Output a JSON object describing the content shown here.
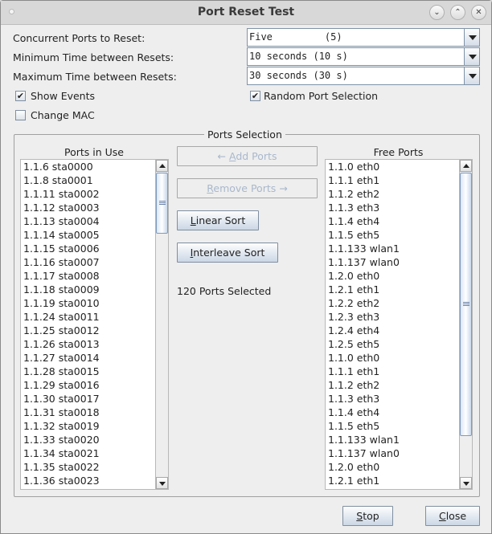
{
  "window": {
    "title": "Port Reset Test"
  },
  "form": {
    "concurrent": {
      "label": "Concurrent Ports to Reset:",
      "value": "Five         (5)"
    },
    "min_time": {
      "label": "Minimum Time between Resets:",
      "value": "10 seconds (10 s)"
    },
    "max_time": {
      "label": "Maximum Time between Resets:",
      "value": "30 seconds (30 s)"
    },
    "show_events": {
      "label": "Show Events",
      "checked": true
    },
    "random_port": {
      "label": "Random Port Selection",
      "checked": true
    },
    "change_mac": {
      "label": "Change MAC",
      "checked": false
    }
  },
  "ports": {
    "group_title": "Ports Selection",
    "in_use_header": "Ports in Use",
    "free_header": "Free Ports",
    "add_prefix": "← ",
    "add_u": "A",
    "add_rest": "dd Ports",
    "remove_u": "R",
    "remove_rest": "emove Ports →",
    "linear_u": "L",
    "linear_rest": "inear Sort",
    "interleave_u": "I",
    "interleave_rest": "nterleave Sort",
    "selected_status": "120 Ports Selected",
    "in_use": [
      "1.1.6 sta0000",
      "1.1.8 sta0001",
      "1.1.11 sta0002",
      "1.1.12 sta0003",
      "1.1.13 sta0004",
      "1.1.14 sta0005",
      "1.1.15 sta0006",
      "1.1.16 sta0007",
      "1.1.17 sta0008",
      "1.1.18 sta0009",
      "1.1.19 sta0010",
      "1.1.24 sta0011",
      "1.1.25 sta0012",
      "1.1.26 sta0013",
      "1.1.27 sta0014",
      "1.1.28 sta0015",
      "1.1.29 sta0016",
      "1.1.30 sta0017",
      "1.1.31 sta0018",
      "1.1.32 sta0019",
      "1.1.33 sta0020",
      "1.1.34 sta0021",
      "1.1.35 sta0022",
      "1.1.36 sta0023"
    ],
    "free": [
      "1.1.0 eth0",
      "1.1.1 eth1",
      "1.1.2 eth2",
      "1.1.3 eth3",
      "1.1.4 eth4",
      "1.1.5 eth5",
      "1.1.133 wlan1",
      "1.1.137 wlan0",
      "1.2.0 eth0",
      "1.2.1 eth1",
      "1.2.2 eth2",
      "1.2.3 eth3",
      "1.2.4 eth4",
      "1.2.5 eth5",
      "1.1.0 eth0",
      "1.1.1 eth1",
      "1.1.2 eth2",
      "1.1.3 eth3",
      "1.1.4 eth4",
      "1.1.5 eth5",
      "1.1.133 wlan1",
      "1.1.137 wlan0",
      "1.2.0 eth0",
      "1.2.1 eth1"
    ]
  },
  "footer": {
    "stop_u": "S",
    "stop_rest": "top",
    "close_u": "C",
    "close_rest": "lose"
  }
}
